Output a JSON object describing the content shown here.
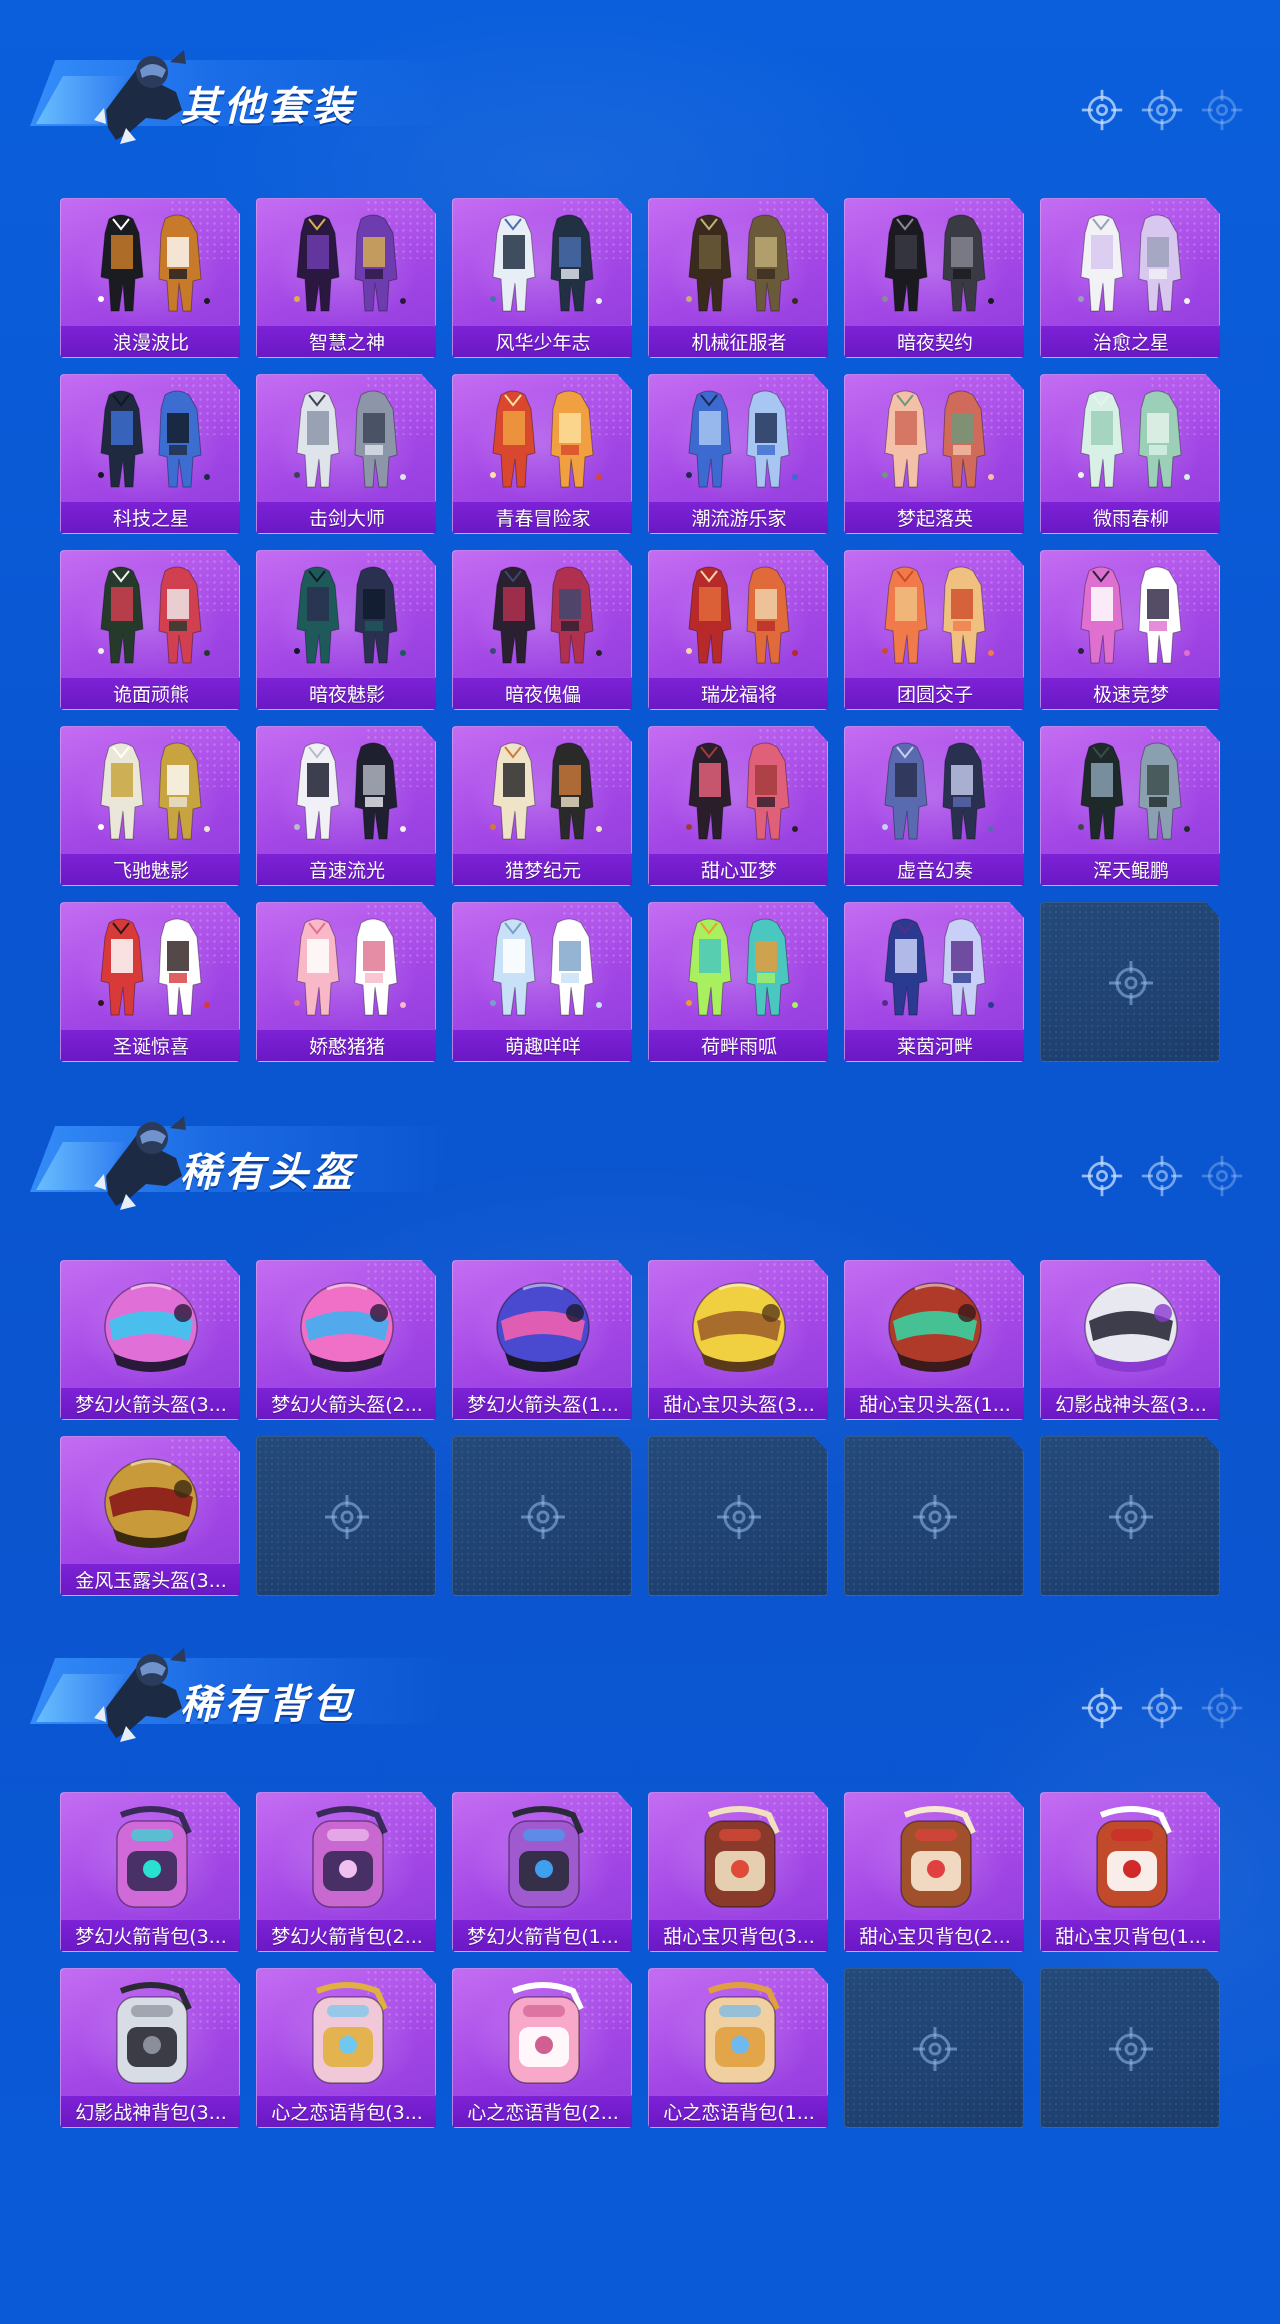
{
  "colors": {
    "background": "#0b5fdc",
    "card_purple": "#a346e6",
    "label_bar": "#6a18c4",
    "empty_slot": "#1f4272",
    "title_text": "#ffffff"
  },
  "sections": [
    {
      "title": "其他套装",
      "items": [
        {
          "label": "浪漫波比",
          "art": "outfit-icon"
        },
        {
          "label": "智慧之神",
          "art": "outfit-icon"
        },
        {
          "label": "风华少年志",
          "art": "outfit-icon"
        },
        {
          "label": "机械征服者",
          "art": "outfit-icon"
        },
        {
          "label": "暗夜契约",
          "art": "outfit-icon"
        },
        {
          "label": "治愈之星",
          "art": "outfit-icon"
        },
        {
          "label": "科技之星",
          "art": "outfit-icon"
        },
        {
          "label": "击剑大师",
          "art": "outfit-icon"
        },
        {
          "label": "青春冒险家",
          "art": "outfit-icon"
        },
        {
          "label": "潮流游乐家",
          "art": "outfit-icon"
        },
        {
          "label": "梦起落英",
          "art": "outfit-icon"
        },
        {
          "label": "微雨春柳",
          "art": "outfit-icon"
        },
        {
          "label": "诡面顽熊",
          "art": "outfit-icon"
        },
        {
          "label": "暗夜魅影",
          "art": "outfit-icon"
        },
        {
          "label": "暗夜傀儡",
          "art": "outfit-icon"
        },
        {
          "label": "瑞龙福将",
          "art": "outfit-icon"
        },
        {
          "label": "团圆交子",
          "art": "outfit-icon"
        },
        {
          "label": "极速竞梦",
          "art": "outfit-icon"
        },
        {
          "label": "飞驰魅影",
          "art": "outfit-icon"
        },
        {
          "label": "音速流光",
          "art": "outfit-icon"
        },
        {
          "label": "猎梦纪元",
          "art": "outfit-icon"
        },
        {
          "label": "甜心亚梦",
          "art": "outfit-icon"
        },
        {
          "label": "虚音幻奏",
          "art": "outfit-icon"
        },
        {
          "label": "浑天鲲鹏",
          "art": "outfit-icon"
        },
        {
          "label": "圣诞惊喜",
          "art": "outfit-icon"
        },
        {
          "label": "娇憨猪猪",
          "art": "outfit-icon"
        },
        {
          "label": "萌趣咩咩",
          "art": "outfit-icon"
        },
        {
          "label": "荷畔雨呱",
          "art": "outfit-icon"
        },
        {
          "label": "莱茵河畔",
          "art": "outfit-icon"
        }
      ],
      "empty_slots": 1
    },
    {
      "title": "稀有头盔",
      "items": [
        {
          "label": "梦幻火箭头盔(3...",
          "art": "helmet-icon"
        },
        {
          "label": "梦幻火箭头盔(2...",
          "art": "helmet-icon"
        },
        {
          "label": "梦幻火箭头盔(1...",
          "art": "helmet-icon"
        },
        {
          "label": "甜心宝贝头盔(3...",
          "art": "helmet-icon"
        },
        {
          "label": "甜心宝贝头盔(1...",
          "art": "helmet-icon"
        },
        {
          "label": "幻影战神头盔(3...",
          "art": "helmet-icon"
        },
        {
          "label": "金风玉露头盔(3...",
          "art": "helmet-icon"
        }
      ],
      "empty_slots": 5
    },
    {
      "title": "稀有背包",
      "items": [
        {
          "label": "梦幻火箭背包(3...",
          "art": "backpack-icon"
        },
        {
          "label": "梦幻火箭背包(2...",
          "art": "backpack-icon"
        },
        {
          "label": "梦幻火箭背包(1...",
          "art": "backpack-icon"
        },
        {
          "label": "甜心宝贝背包(3...",
          "art": "backpack-icon"
        },
        {
          "label": "甜心宝贝背包(2...",
          "art": "backpack-icon"
        },
        {
          "label": "甜心宝贝背包(1...",
          "art": "backpack-icon"
        },
        {
          "label": "幻影战神背包(3...",
          "art": "backpack-icon"
        },
        {
          "label": "心之恋语背包(3...",
          "art": "backpack-icon"
        },
        {
          "label": "心之恋语背包(2...",
          "art": "backpack-icon"
        },
        {
          "label": "心之恋语背包(1...",
          "art": "backpack-icon"
        }
      ],
      "empty_slots": 2
    }
  ]
}
